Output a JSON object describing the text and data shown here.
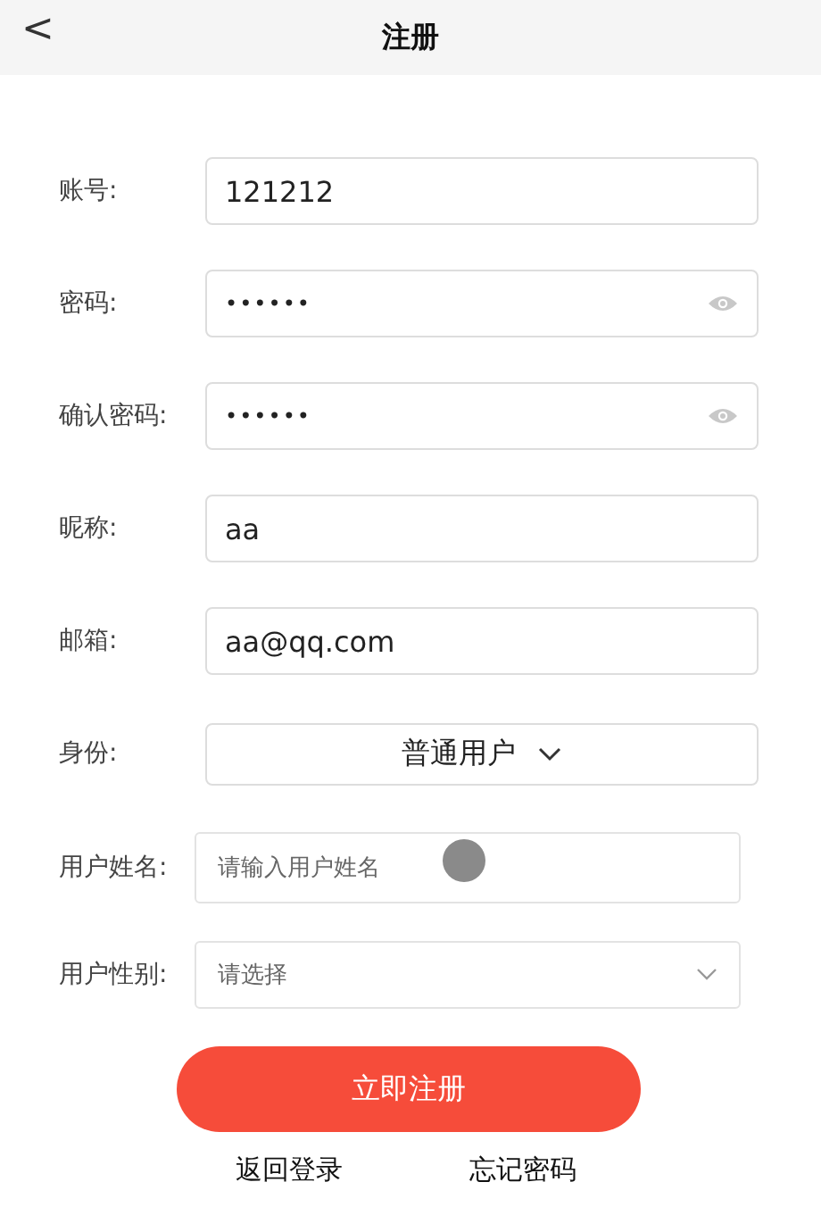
{
  "header": {
    "back": "<",
    "title": "注册"
  },
  "fields": [
    {
      "kind": "text",
      "label": "账号:",
      "value": "121212"
    },
    {
      "kind": "password",
      "label": "密码:",
      "value": "••••••"
    },
    {
      "kind": "password",
      "label": "确认密码:",
      "value": "••••••"
    },
    {
      "kind": "text",
      "label": "昵称:",
      "value": "aa"
    },
    {
      "kind": "text",
      "label": "邮箱:",
      "value": "aa@qq.com"
    },
    {
      "kind": "picker",
      "label": "身份:",
      "value": "普通用户"
    }
  ],
  "extra_fields": [
    {
      "kind": "input",
      "label": "用户姓名:",
      "placeholder": "请输入用户姓名"
    },
    {
      "kind": "select",
      "label": "用户性别:",
      "placeholder": "请选择"
    }
  ],
  "submit": "立即注册",
  "links": [
    "返回登录",
    "忘记密码"
  ]
}
